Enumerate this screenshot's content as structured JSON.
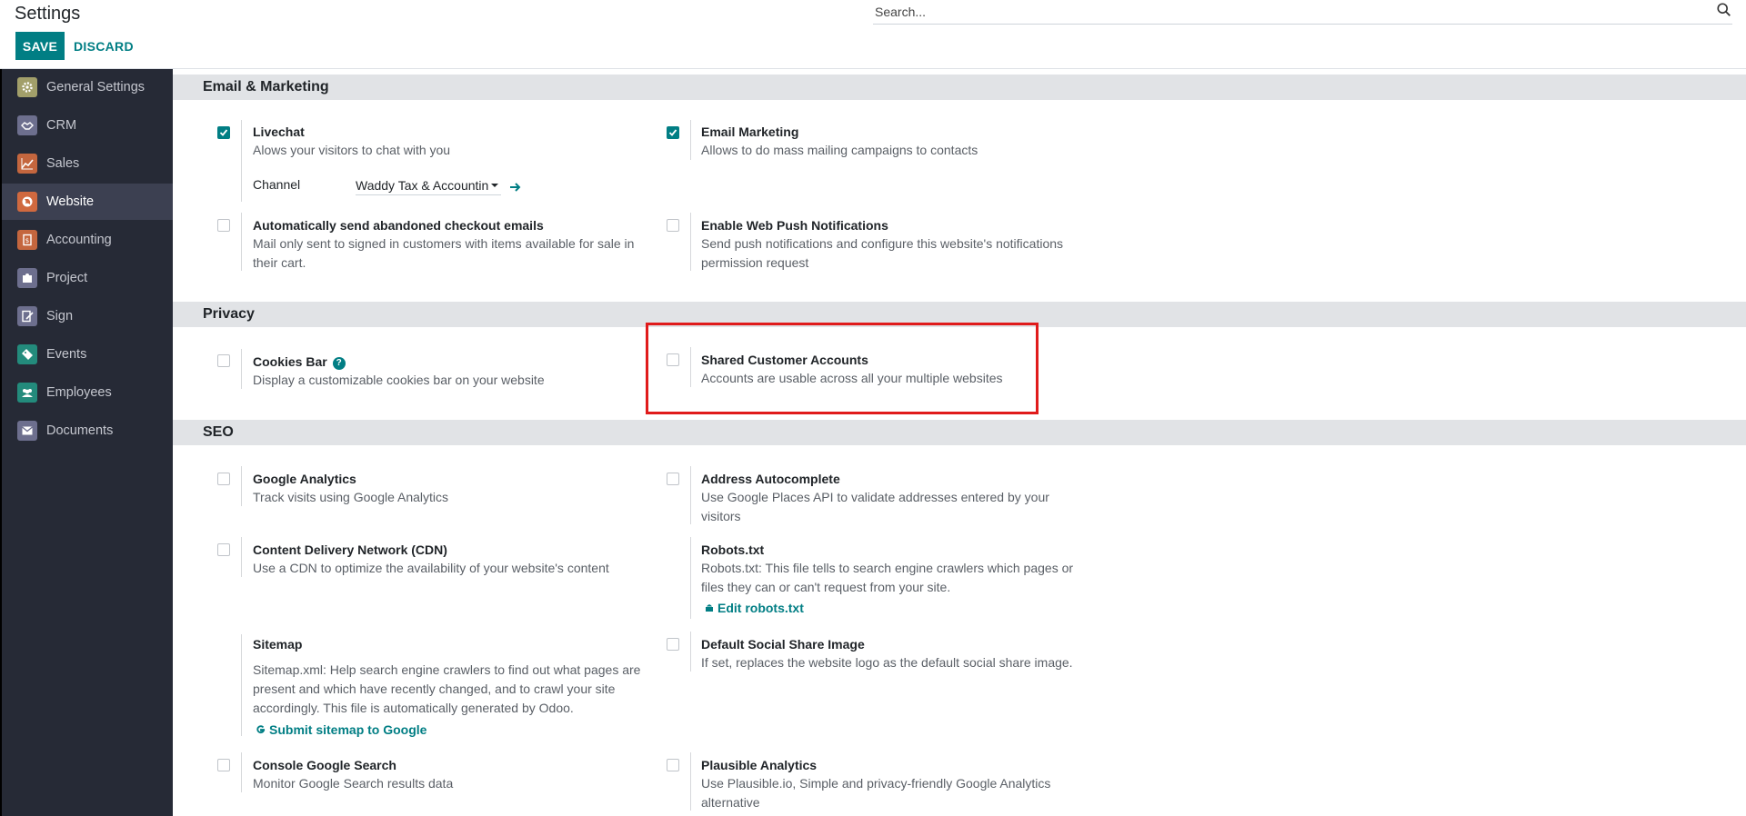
{
  "header": {
    "title": "Settings",
    "save_label": "SAVE",
    "discard_label": "DISCARD",
    "search_placeholder": "Search..."
  },
  "sidebar": {
    "items": [
      {
        "label": "General Settings",
        "icon": "gear-icon",
        "color": "#a29f6a"
      },
      {
        "label": "CRM",
        "icon": "handshake-icon",
        "color": "#6d6f8e"
      },
      {
        "label": "Sales",
        "icon": "chart-line-icon",
        "color": "#c4663e"
      },
      {
        "label": "Website",
        "icon": "globe-icon",
        "color": "#d0693f",
        "active": true
      },
      {
        "label": "Accounting",
        "icon": "accounting-icon",
        "color": "#c4663e"
      },
      {
        "label": "Project",
        "icon": "puzzle-icon",
        "color": "#6d6f8e"
      },
      {
        "label": "Sign",
        "icon": "sign-icon",
        "color": "#6d6f8e"
      },
      {
        "label": "Events",
        "icon": "ticket-icon",
        "color": "#238b7c"
      },
      {
        "label": "Employees",
        "icon": "users-icon",
        "color": "#238b7c"
      },
      {
        "label": "Documents",
        "icon": "inbox-icon",
        "color": "#6d6f8e"
      }
    ]
  },
  "sections": {
    "email_marketing": "Email & Marketing",
    "privacy": "Privacy",
    "seo": "SEO"
  },
  "settings": {
    "livechat": {
      "title": "Livechat",
      "desc": "Alows your visitors to chat with you",
      "checked": true,
      "channel_label": "Channel",
      "channel_value": "Waddy Tax & Accountin"
    },
    "email_marketing": {
      "title": "Email Marketing",
      "desc": "Allows to do mass mailing campaigns to contacts",
      "checked": true
    },
    "abandoned": {
      "title": "Automatically send abandoned checkout emails",
      "desc": "Mail only sent to signed in customers with items available for sale in their cart."
    },
    "web_push": {
      "title": "Enable Web Push Notifications",
      "desc": "Send push notifications and configure this website's notifications permission request"
    },
    "cookies": {
      "title": "Cookies Bar",
      "desc": "Display a customizable cookies bar on your website",
      "help": "?"
    },
    "shared_accounts": {
      "title": "Shared Customer Accounts",
      "desc": "Accounts are usable across all your multiple websites"
    },
    "google_analytics": {
      "title": "Google Analytics",
      "desc": "Track visits using Google Analytics"
    },
    "address_autocomplete": {
      "title": "Address Autocomplete",
      "desc": "Use Google Places API to validate addresses entered by your visitors"
    },
    "cdn": {
      "title": "Content Delivery Network (CDN)",
      "desc": "Use a CDN to optimize the availability of your website's content"
    },
    "robots": {
      "title": "Robots.txt",
      "desc": "Robots.txt: This file tells to search engine crawlers which pages or files they can or can't request from your site.",
      "link": "Edit robots.txt"
    },
    "sitemap": {
      "title": "Sitemap",
      "desc": "Sitemap.xml: Help search engine crawlers to find out what pages are present and which have recently changed, and to crawl your site accordingly. This file is automatically generated by Odoo.",
      "link": "Submit sitemap to Google"
    },
    "social_image": {
      "title": "Default Social Share Image",
      "desc": "If set, replaces the website logo as the default social share image."
    },
    "console_search": {
      "title": "Console Google Search",
      "desc": "Monitor Google Search results data"
    },
    "plausible": {
      "title": "Plausible Analytics",
      "desc": "Use Plausible.io, Simple and privacy-friendly Google Analytics alternative"
    }
  },
  "colors": {
    "accent": "#017e84",
    "sidebar_bg": "#262a36",
    "highlight": "#e01b1b"
  }
}
